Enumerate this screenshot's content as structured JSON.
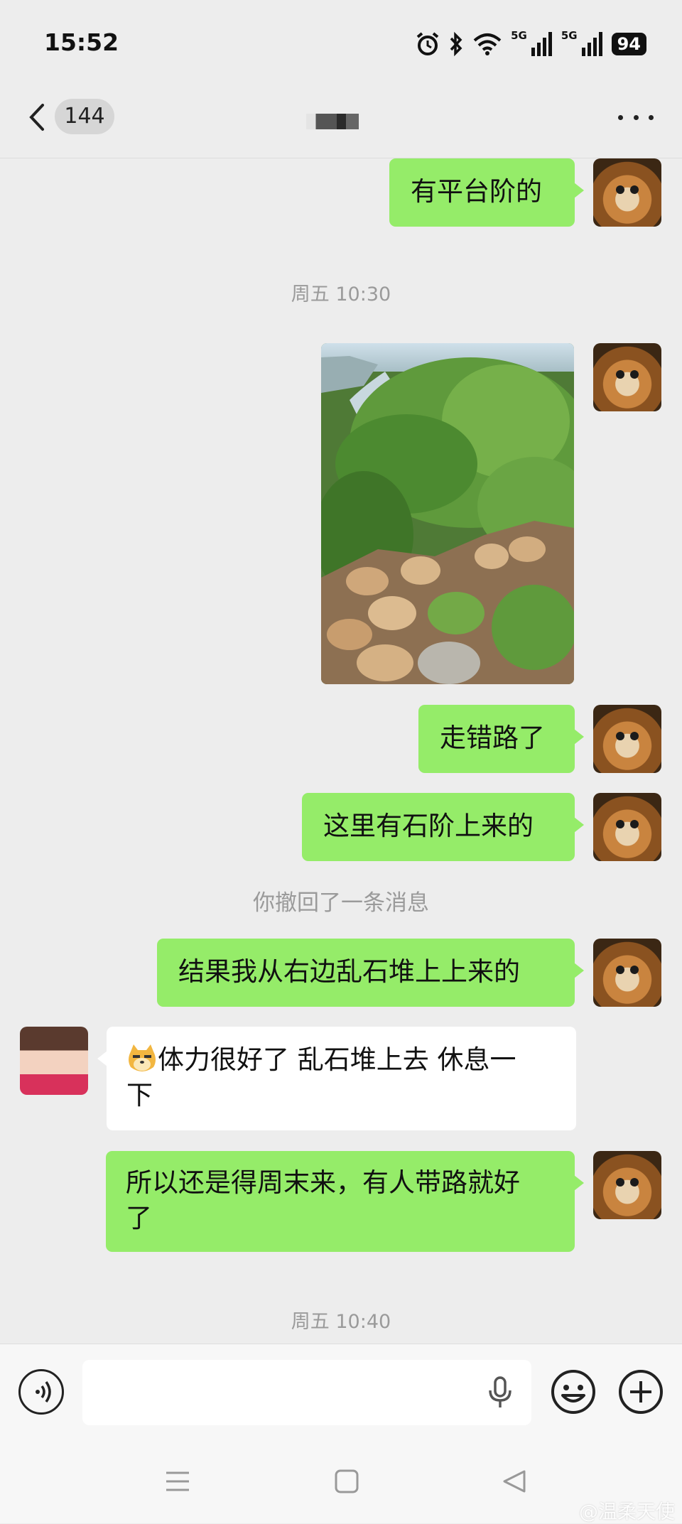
{
  "status_bar": {
    "time": "15:52",
    "net1": "5G",
    "net2": "5G",
    "battery": "94"
  },
  "header": {
    "unread_count": "144"
  },
  "messages": {
    "m1": "有平台阶的",
    "t1": "周五 10:30",
    "m2": "走错路了",
    "m3": "这里有石阶上来的",
    "recall": "你撤回了一条消息",
    "m4": "结果我从右边乱石堆上上来的",
    "m5_line1": "体力很好了 乱石堆上去  休息一",
    "m5_line2": "下",
    "m6_line1": "所以还是得周末来，有人带路就好",
    "m6_line2": "了",
    "t2": "周五 10:40"
  },
  "input": {
    "value": "",
    "placeholder": ""
  },
  "watermark": "@温柔天使",
  "icons": {
    "back": "chevron-left-icon",
    "more": "more-dots-icon",
    "voice": "voice-icon",
    "mic": "microphone-icon",
    "emoji": "smiley-icon",
    "plus": "plus-icon",
    "nav_menu": "menu-icon",
    "nav_home": "home-square-icon",
    "nav_back": "back-triangle-icon"
  },
  "colors": {
    "bubble_green": "#95ec69",
    "background": "#ededed",
    "time_gray": "#9a9a9a"
  }
}
